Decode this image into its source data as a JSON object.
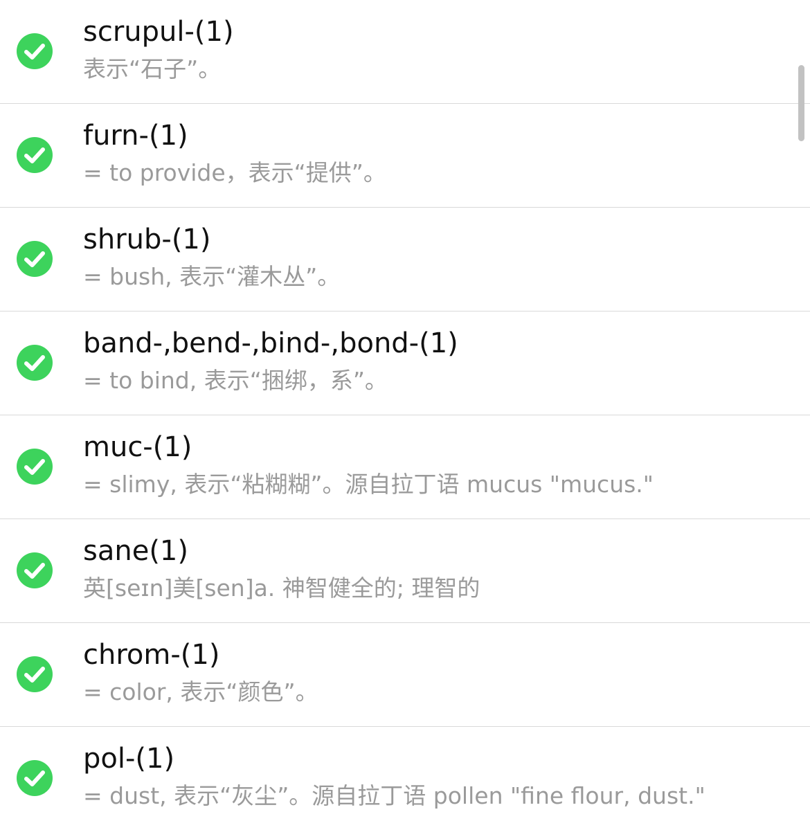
{
  "colors": {
    "check": "#3dd35c",
    "term": "#111111",
    "definition": "#9a9a9a",
    "divider": "#d9d9d9"
  },
  "items": [
    {
      "term": "scrupul-(1)",
      "definition": "表示“石子”。",
      "icon": "check-circle-icon"
    },
    {
      "term": "furn-(1)",
      "definition": "= to provide，表示“提供”。",
      "icon": "check-circle-icon"
    },
    {
      "term": "shrub-(1)",
      "definition": "= bush, 表示“灌木丛”。",
      "icon": "check-circle-icon"
    },
    {
      "term": "band-,bend-,bind-,bond-(1)",
      "definition": "= to bind, 表示“捆绑，系”。",
      "icon": "check-circle-icon"
    },
    {
      "term": "muc-(1)",
      "definition": "= slimy, 表示“粘糊糊”。源自拉丁语 mucus \"mucus.\"",
      "icon": "check-circle-icon"
    },
    {
      "term": "sane(1)",
      "definition": "英[seɪn]美[sen]a. 神智健全的; 理智的",
      "icon": "check-circle-icon"
    },
    {
      "term": "chrom-(1)",
      "definition": "= color, 表示“颜色”。",
      "icon": "check-circle-icon"
    },
    {
      "term": "pol-(1)",
      "definition": "= dust, 表示“灰尘”。源自拉丁语 pollen \"fine flour, dust.\"",
      "icon": "check-circle-icon"
    }
  ]
}
